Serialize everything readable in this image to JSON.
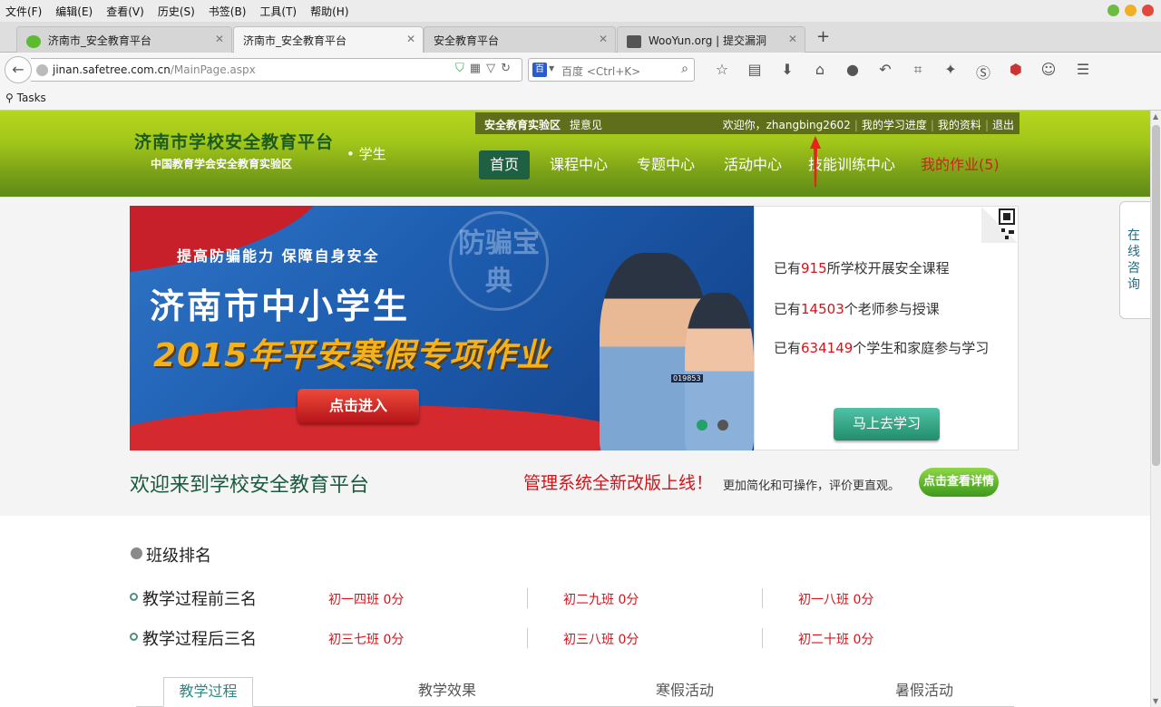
{
  "browser": {
    "menu": [
      "文件(F)",
      "编辑(E)",
      "查看(V)",
      "历史(S)",
      "书签(B)",
      "工具(T)",
      "帮助(H)"
    ],
    "tabs": [
      {
        "label": "济南市_安全教育平台",
        "active": false
      },
      {
        "label": "济南市_安全教育平台",
        "active": true
      },
      {
        "label": "安全教育平台",
        "active": false
      },
      {
        "label": "WooYun.org | 提交漏洞",
        "active": false
      }
    ],
    "new_tab": "+",
    "url_host": "jinan.safetree.com.cn",
    "url_path": "/MainPage.aspx",
    "search_engine": "百度",
    "search_placeholder": "<Ctrl+K>",
    "bookmark_tasks": "Tasks",
    "colors": {
      "tab_active": "#f5f5f5",
      "chrome": "#ececec"
    }
  },
  "header": {
    "brand_title": "济南市学校安全教育平台",
    "brand_sub": "中国教育学会安全教育实验区",
    "role": "• 学生",
    "topbar": {
      "lab": "安全教育实验区",
      "feedback": "提意见",
      "welcome": "欢迎你，zhangbing2602",
      "progress": "我的学习进度",
      "profile": "我的资料",
      "logout": "退出"
    },
    "nav": [
      "首页",
      "课程中心",
      "专题中心",
      "活动中心",
      "技能训练中心",
      "我的作业(5)"
    ],
    "colors": {
      "header_top": "#b6d61f",
      "header_bottom": "#5d8a17",
      "nav_active": "#1f5f42",
      "homework": "#c4271c"
    }
  },
  "banner": {
    "slogan": "提高防骗能力   保障自身安全",
    "stamp": "防骗宝典",
    "headline1": "济南市中小学生",
    "headline2": "2015年平安寒假专项作业",
    "enter_button": "点击进入",
    "officer_badge": "019853"
  },
  "stats": {
    "schools_prefix": "已有",
    "schools": "915",
    "schools_suffix": "所学校开展安全课程",
    "teachers_prefix": "已有",
    "teachers": "14503",
    "teachers_suffix": "个老师参与授课",
    "students_prefix": "已有",
    "students": "634149",
    "students_suffix": "个学生和家庭参与学习",
    "learn_button": "马上去学习"
  },
  "consult": "在线咨询",
  "welcome_bar": {
    "welcome": "欢迎来到学校安全教育平台",
    "notice": "管理系统全新改版上线！",
    "notice_sub": "更加简化和可操作，评价更直观。",
    "detail_button": "点击查看详情"
  },
  "ranking": {
    "title": "班级排名",
    "rows": [
      {
        "label": "教学过程前三名",
        "cells": [
          "初一四班  0分",
          "初二九班  0分",
          "初一八班  0分"
        ]
      },
      {
        "label": "教学过程后三名",
        "cells": [
          "初三七班  0分",
          "初三八班  0分",
          "初二十班  0分"
        ]
      }
    ],
    "tabs": [
      "教学过程",
      "教学效果",
      "寒假活动",
      "暑假活动"
    ]
  }
}
